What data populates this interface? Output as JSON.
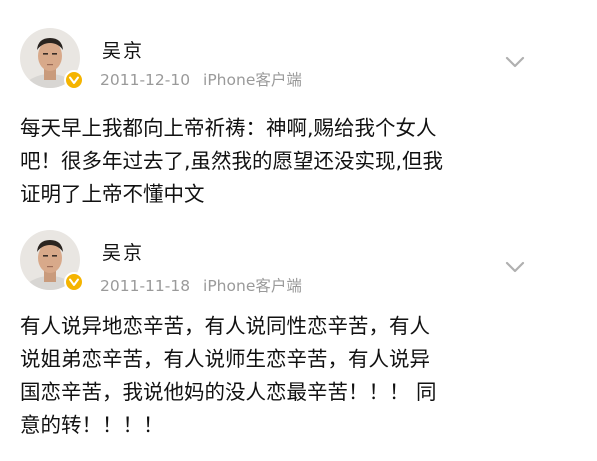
{
  "posts": [
    {
      "author": "吴京",
      "date": "2011-12-10",
      "source": "iPhone客户端",
      "lines": [
        "每天早上我都向上帝祈祷：神啊,赐给我个女人",
        "吧！很多年过去了,虽然我的愿望还没实现,但我",
        "证明了上帝不懂中文"
      ]
    },
    {
      "author": "吴京",
      "date": "2011-11-18",
      "source": "iPhone客户端",
      "lines": [
        "有人说异地恋辛苦，有人说同性恋辛苦，有人",
        "说姐弟恋辛苦，有人说师生恋辛苦，有人说异",
        "国恋辛苦，我说他妈的没人恋最辛苦！！！ 同",
        "意的转！！！！"
      ]
    }
  ],
  "colors": {
    "text": "#111111",
    "meta": "#9a9a9a",
    "badge": "#f5b400",
    "chevron": "#b0b0b0"
  },
  "icons": {
    "avatar": "avatar",
    "badge": "verified-badge-icon",
    "more": "chevron-down-icon"
  }
}
